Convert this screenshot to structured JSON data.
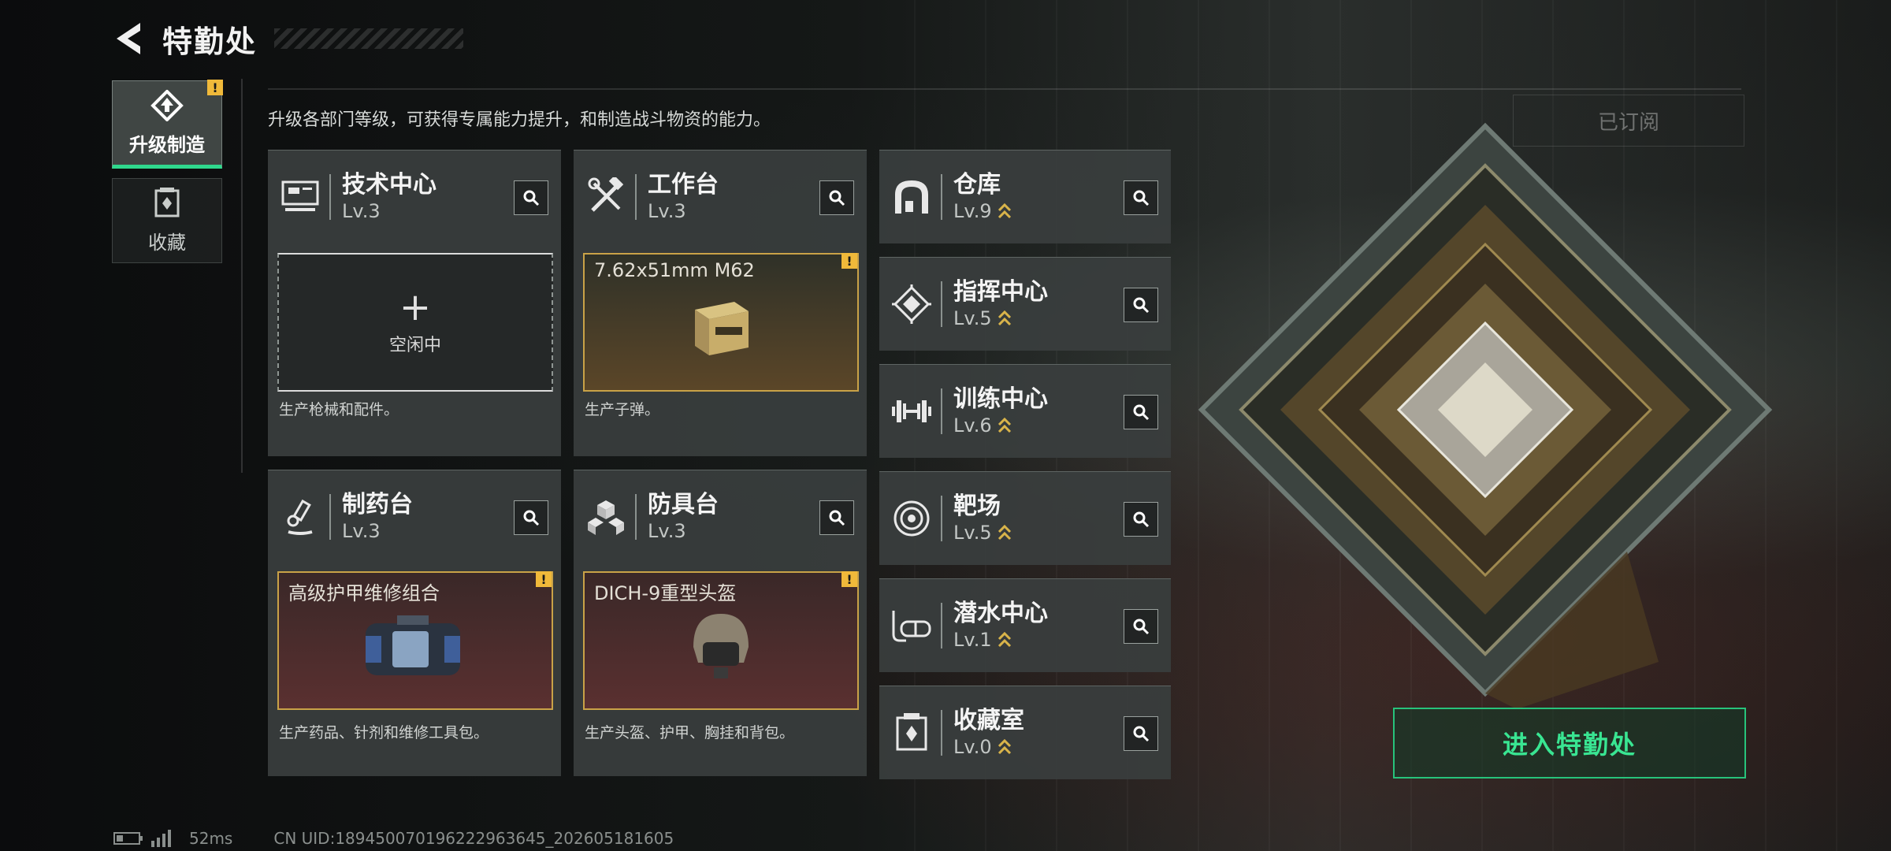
{
  "header": {
    "title": "特勤处"
  },
  "sidebar": {
    "items": [
      {
        "label": "升级制造",
        "active": true,
        "warning": "!"
      },
      {
        "label": "收藏",
        "active": false
      }
    ]
  },
  "description": "升级各部门等级，可获得专属能力提升，和制造战斗物资的能力。",
  "subscribe_label": "已订阅",
  "cards": {
    "tech": {
      "name": "技术中心",
      "level": "Lv.3",
      "slot_text": "空闲中",
      "slot_plus": "+",
      "desc": "生产枪械和配件。"
    },
    "workbench": {
      "name": "工作台",
      "level": "Lv.3",
      "item": "7.62x51mm M62",
      "warning": "!",
      "desc": "生产子弹。"
    },
    "pharmacy": {
      "name": "制药台",
      "level": "Lv.3",
      "item": "高级护甲维修组合",
      "warning": "!",
      "desc": "生产药品、针剂和维修工具包。"
    },
    "armor": {
      "name": "防具台",
      "level": "Lv.3",
      "item": "DICH-9重型头盔",
      "warning": "!",
      "desc": "生产头盔、护甲、胸挂和背包。"
    },
    "warehouse": {
      "name": "仓库",
      "level": "Lv.9"
    },
    "command": {
      "name": "指挥中心",
      "level": "Lv.5"
    },
    "training": {
      "name": "训练中心",
      "level": "Lv.6"
    },
    "range": {
      "name": "靶场",
      "level": "Lv.5"
    },
    "diving": {
      "name": "潜水中心",
      "level": "Lv.1"
    },
    "collection": {
      "name": "收藏室",
      "level": "Lv.0"
    }
  },
  "enter_button": "进入特勤处",
  "footer": {
    "ping": "52ms",
    "uid": "CN UID:189450070196222963645_202605181605"
  },
  "colors": {
    "accent_green": "#2fd88d",
    "warning_yellow": "#f0b93a",
    "upgrade_gold": "#d9b44a"
  },
  "icons": [
    "back-arrow-icon",
    "upgrade-craft-icon",
    "collection-icon",
    "search-icon",
    "monitor-icon",
    "tools-icon",
    "arch-icon",
    "chip-icon",
    "dumbbell-icon",
    "target-icon",
    "flask-icon",
    "cubes-icon",
    "diving-mask-icon",
    "trophy-icon",
    "upgrade-chevrons-icon",
    "battery-icon",
    "signal-icon"
  ]
}
